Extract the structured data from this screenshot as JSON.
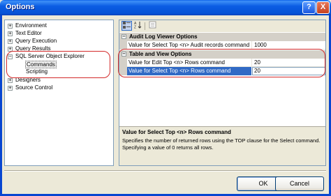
{
  "window": {
    "title": "Options"
  },
  "titlebar_buttons": {
    "help": "?",
    "close": "X"
  },
  "tree": {
    "items": [
      {
        "label": "Environment",
        "expander": "+"
      },
      {
        "label": "Text Editor",
        "expander": "+"
      },
      {
        "label": "Query Execution",
        "expander": "+"
      },
      {
        "label": "Query Results",
        "expander": "+"
      },
      {
        "label": "SQL Server Object Explorer",
        "expander": "−"
      },
      {
        "label": "Commands",
        "expander": ""
      },
      {
        "label": "Scripting",
        "expander": ""
      },
      {
        "label": "Designers",
        "expander": "+"
      },
      {
        "label": "Source Control",
        "expander": "+"
      }
    ]
  },
  "grid": {
    "toolbar": {
      "categorized_icon": "categorized-icon",
      "alphabetical_icon": "alphabetical-icon",
      "pages_icon": "property-pages-icon"
    },
    "categories": [
      {
        "label": "Audit Log Viewer Options",
        "expander": "−",
        "properties": [
          {
            "name": "Value for Select Top <n> Audit records command",
            "value": "1000"
          }
        ]
      },
      {
        "label": "Table and View Options",
        "expander": "−",
        "properties": [
          {
            "name": "Value for Edit Top <n> Rows command",
            "value": "20"
          },
          {
            "name": "Value for Select Top <n> Rows command",
            "value": "20"
          }
        ]
      }
    ],
    "description": {
      "title": "Value for Select Top <n> Rows command",
      "text": "Specifies the number of returned rows using the TOP clause for the Select command. Specifying a value of 0 returns all rows."
    }
  },
  "buttons": {
    "ok": "OK",
    "cancel": "Cancel"
  },
  "colors": {
    "highlight_box": "#d32a2a",
    "selection": "#316ac5",
    "titlebar": "#0552d6"
  }
}
